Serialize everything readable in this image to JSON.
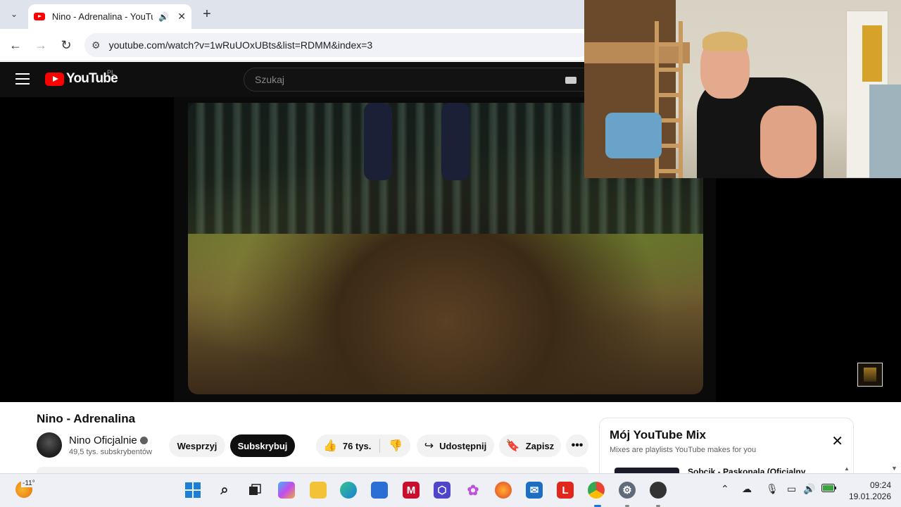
{
  "browser": {
    "tab": {
      "title": "Nino - Adrenalina - YouTube"
    },
    "url": "youtube.com/watch?v=1wRuUOxUBts&list=RDMM&index=3"
  },
  "youtube": {
    "logo_text": "YouTube",
    "region": "PL",
    "search_placeholder": "Szukaj"
  },
  "video": {
    "title": "Nino - Adrenalina",
    "channel": "Nino Oficjalnie",
    "subscribers": "49,5 tys. subskrybentów",
    "support_label": "Wesprzyj",
    "subscribe_label": "Subskrybuj",
    "likes": "76 tys.",
    "share_label": "Udostępnij",
    "save_label": "Zapisz"
  },
  "mix_panel": {
    "title": "Mój YouTube Mix",
    "subtitle": "Mixes are playlists YouTube makes for you",
    "first_item": "Sobcik - Paskonala (Oficjalny"
  },
  "taskbar": {
    "weather_temp": "-11°",
    "time": "09:24",
    "date": "19.01.2026"
  },
  "icons": [
    "chevron-down-icon",
    "audio-icon",
    "close-icon",
    "plus-icon",
    "back-icon",
    "forward-icon",
    "reload-icon",
    "tune-icon",
    "hamburger-icon",
    "youtube-logo-icon",
    "keyboard-icon",
    "verified-icon",
    "like-icon",
    "dislike-icon",
    "share-icon",
    "save-icon",
    "more-icon",
    "windows-start-icon",
    "search-icon",
    "task-view-icon",
    "copilot-icon",
    "file-explorer-icon",
    "edge-icon",
    "store-icon",
    "mcafee-icon",
    "vpn-icon",
    "photos-icon",
    "firefox-icon",
    "outlook-icon",
    "lenovo-icon",
    "chrome-icon",
    "settings-icon",
    "obs-icon",
    "chevron-up-icon",
    "cloud-icon",
    "mic-icon",
    "display-icon",
    "volume-icon",
    "battery-icon"
  ]
}
